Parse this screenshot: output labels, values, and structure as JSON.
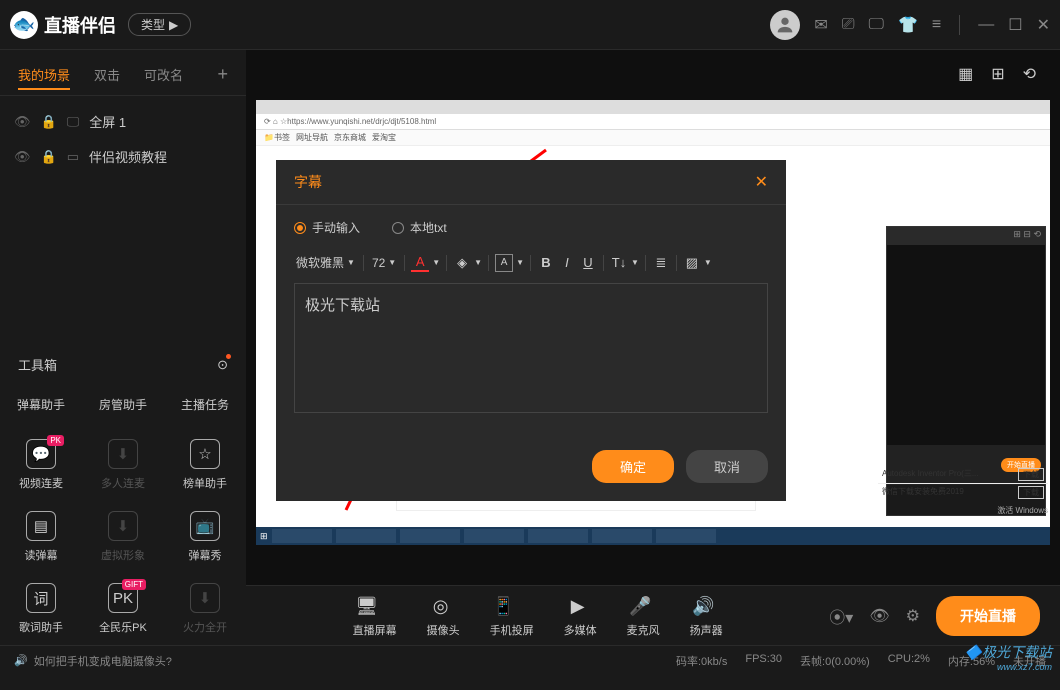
{
  "titlebar": {
    "logo": "直播伴侣",
    "type_btn": "类型"
  },
  "tabs": {
    "scenes": "我的场景",
    "dblclick": "双击",
    "rename": "可改名"
  },
  "scenes": [
    {
      "label": "全屏 1"
    },
    {
      "label": "伴侣视频教程"
    }
  ],
  "toolbox": {
    "header": "工具箱",
    "links": {
      "danmu": "弹幕助手",
      "fangguan": "房管助手",
      "zhubo": "主播任务"
    },
    "tools": [
      {
        "label": "视频连麦",
        "badge": "PK"
      },
      {
        "label": "多人连麦"
      },
      {
        "label": "榜单助手"
      },
      {
        "label": "读弹幕"
      },
      {
        "label": "虚拟形象"
      },
      {
        "label": "弹幕秀"
      },
      {
        "label": "歌词助手"
      },
      {
        "label": "全民乐PK",
        "badge": "GIFT"
      },
      {
        "label": "火力全开"
      }
    ]
  },
  "canvas": {
    "dialog": {
      "title": "字幕",
      "radio_manual": "手动输入",
      "radio_txt": "本地txt",
      "font": "微软雅黑",
      "size": "72",
      "textarea_value": "极光下载站",
      "ok": "确定",
      "cancel": "取消"
    },
    "browser_url": "https://www.yunqishi.net/drjc/djt/5108.html"
  },
  "sources": [
    {
      "label": "直播屏幕"
    },
    {
      "label": "摄像头"
    },
    {
      "label": "手机投屏"
    },
    {
      "label": "多媒体"
    },
    {
      "label": "麦克风"
    },
    {
      "label": "扬声器"
    }
  ],
  "start_btn": "开始直播",
  "status": {
    "tip": "如何把手机变成电脑摄像头?",
    "rate": "码率:0kb/s",
    "fps": "FPS:30",
    "drop": "丢帧:0(0.00%)",
    "cpu": "CPU:2%",
    "mem": "内存:56%",
    "open": "未开播"
  },
  "watermark": {
    "name": "极光下载站",
    "url": "www.xz7.com"
  },
  "mini_side": {
    "item1": "Autodesk Inventor Pro(三...",
    "item2": "微信下载安装免费2019",
    "btn": "下载",
    "activate": "激活 Windows"
  }
}
